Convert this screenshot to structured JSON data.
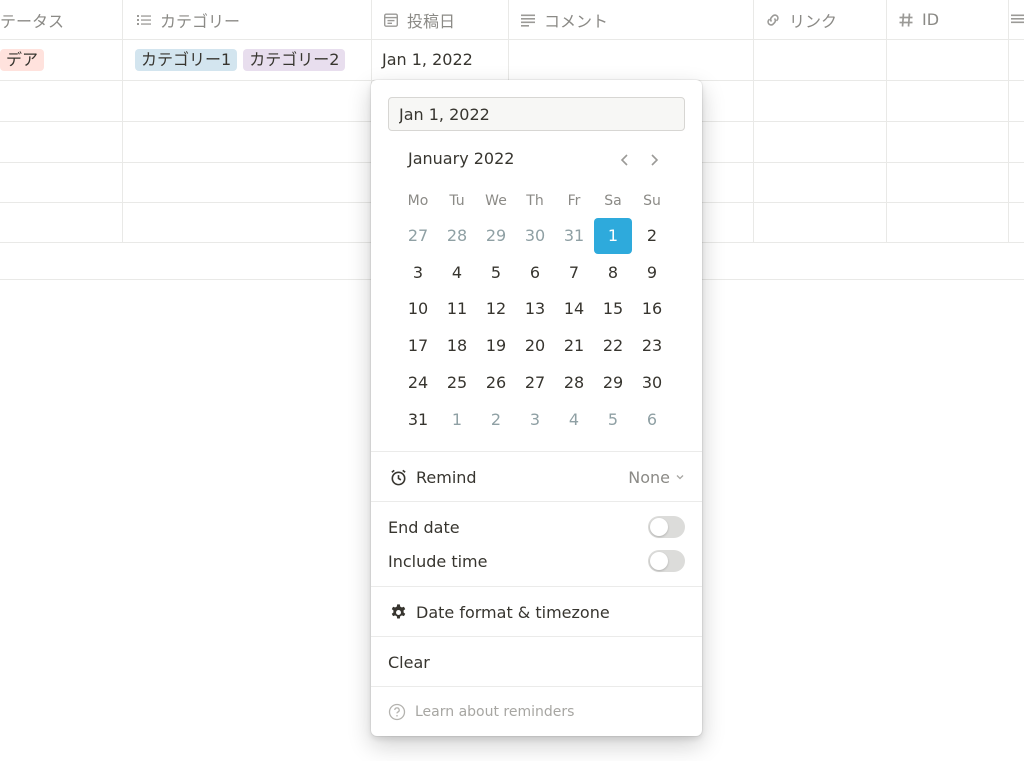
{
  "table": {
    "headers": [
      {
        "label": "テータス",
        "icon": "status-icon"
      },
      {
        "label": "カテゴリー",
        "icon": "list-icon"
      },
      {
        "label": "投稿日",
        "icon": "calendar-icon"
      },
      {
        "label": "コメント",
        "icon": "text-lines-icon"
      },
      {
        "label": "リンク",
        "icon": "link-icon"
      },
      {
        "label": "ID",
        "icon": "hash-icon"
      }
    ],
    "row1": {
      "status": "デア",
      "categories": [
        "カテゴリー1",
        "カテゴリー2"
      ],
      "date": "Jan 1, 2022"
    }
  },
  "datepicker": {
    "input_value": "Jan 1, 2022",
    "month_label": "January 2022",
    "weekdays": [
      "Mo",
      "Tu",
      "We",
      "Th",
      "Fr",
      "Sa",
      "Su"
    ],
    "weeks": [
      [
        "27",
        "28",
        "29",
        "30",
        "31",
        "1",
        "2"
      ],
      [
        "3",
        "4",
        "5",
        "6",
        "7",
        "8",
        "9"
      ],
      [
        "10",
        "11",
        "12",
        "13",
        "14",
        "15",
        "16"
      ],
      [
        "17",
        "18",
        "19",
        "20",
        "21",
        "22",
        "23"
      ],
      [
        "24",
        "25",
        "26",
        "27",
        "28",
        "29",
        "30"
      ],
      [
        "31",
        "1",
        "2",
        "3",
        "4",
        "5",
        "6"
      ]
    ],
    "selected_day": "1",
    "remind_label": "Remind",
    "remind_value": "None",
    "end_date_label": "End date",
    "end_date_on": false,
    "include_time_label": "Include time",
    "include_time_on": false,
    "date_format_label": "Date format & timezone",
    "clear_label": "Clear",
    "learn_label": "Learn about reminders"
  },
  "colors": {
    "selected_day_bg": "#2eaadc",
    "tag_red": "#ffe2dd",
    "tag_blue": "#d3e5ef",
    "tag_purple": "#e8deee"
  }
}
